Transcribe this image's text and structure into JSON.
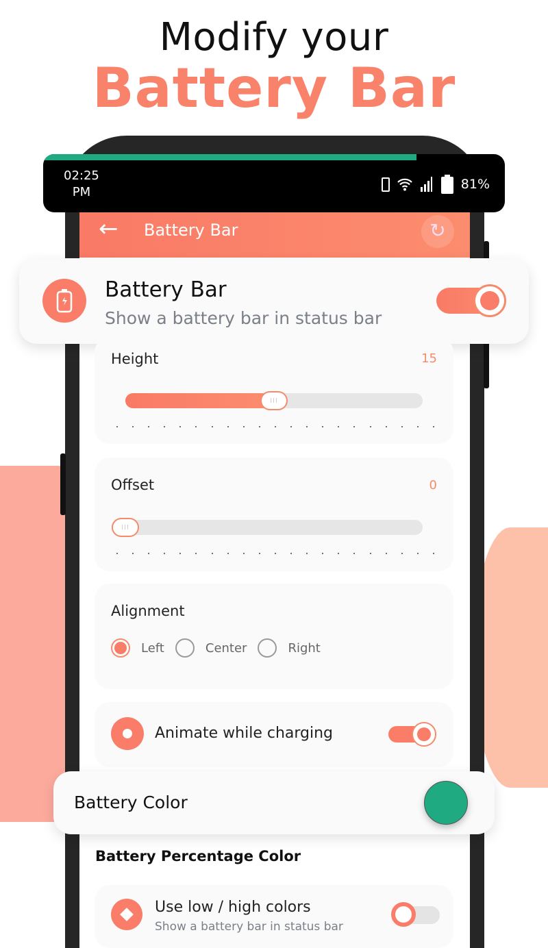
{
  "headline": {
    "line1": "Modify your",
    "line2": "Battery Bar"
  },
  "status_bar": {
    "time": "02:25",
    "ampm": "PM",
    "battery": "81%",
    "battery_bar_fill": 0.81,
    "battery_bar_color": "#1FAA82",
    "icons": [
      "phone-icon",
      "wifi-icon",
      "signal-icon",
      "battery-icon"
    ]
  },
  "app_bar": {
    "title": "Battery Bar",
    "back_icon": "arrow-left-icon",
    "reset_icon": "refresh-icon"
  },
  "battery_bar_card": {
    "title": "Battery Bar",
    "subtitle": "Show a battery bar in status bar",
    "enabled": true,
    "icon": "battery-charging-icon"
  },
  "height": {
    "label": "Height",
    "value": "15",
    "fill": 0.5
  },
  "offset": {
    "label": "Offset",
    "value": "0",
    "fill": 0
  },
  "alignment": {
    "label": "Alignment",
    "options": [
      "Left",
      "Center",
      "Right"
    ],
    "selected": "Left"
  },
  "animate": {
    "label": "Animate while charging",
    "enabled": true
  },
  "battery_color": {
    "label": "Battery Color",
    "color": "#1FAA82"
  },
  "percentage_color": {
    "heading": "Battery Percentage Color",
    "item_title": "Use low / high colors",
    "item_subtitle": "Show a battery bar in status bar",
    "enabled": false
  },
  "colors": {
    "accent": "#F97D68"
  }
}
